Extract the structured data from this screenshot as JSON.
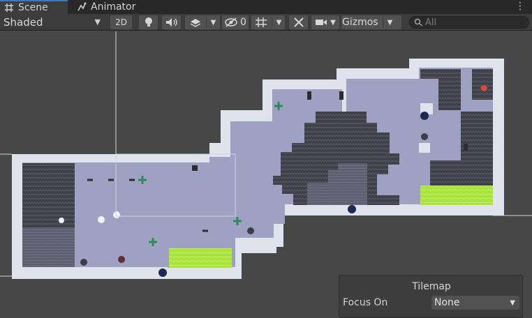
{
  "tabs": [
    {
      "label": "Scene",
      "icon": "hash-grid-icon",
      "active": true
    },
    {
      "label": "Animator",
      "icon": "animator-icon",
      "active": false
    }
  ],
  "toolbar": {
    "draw_mode": "Shaded",
    "mode_2d": "2D",
    "hidden_count": "0",
    "gizmos": "Gizmos",
    "search_placeholder": "All"
  },
  "overlay": {
    "title": "Tilemap",
    "focus_label": "Focus On",
    "focus_value": "None"
  },
  "colors": {
    "scene_bg": "#474747",
    "wall": "#dfe3ec",
    "floor": "#9ea1c2",
    "dark_rock": "#3f4048",
    "acid": "#a9e33d",
    "tab_accent": "#3a79bb"
  }
}
